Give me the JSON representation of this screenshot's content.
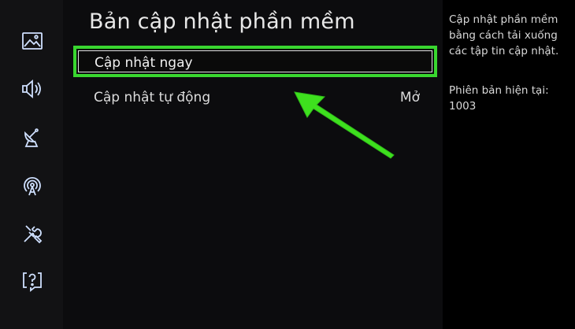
{
  "sidebar": {
    "items": [
      {
        "icon": "picture-icon"
      },
      {
        "icon": "sound-icon"
      },
      {
        "icon": "broadcast-icon"
      },
      {
        "icon": "network-icon"
      },
      {
        "icon": "system-icon"
      },
      {
        "icon": "support-icon"
      }
    ]
  },
  "main": {
    "title": "Bản cập nhật phần mềm",
    "items": [
      {
        "label": "Cập nhật ngay",
        "selected": true
      },
      {
        "label": "Cập nhật tự động",
        "value": "Mở"
      }
    ]
  },
  "description": {
    "text": "Cập nhật phần mềm bằng cách tải xuống các tập tin cập nhật.",
    "version_label": "Phiên bản hiện tại:",
    "version_value": "1003"
  },
  "colors": {
    "focus_highlight": "#39d62f",
    "annotation_arrow": "#3ee01e",
    "background": "#000000",
    "sidebar": "#121214"
  }
}
